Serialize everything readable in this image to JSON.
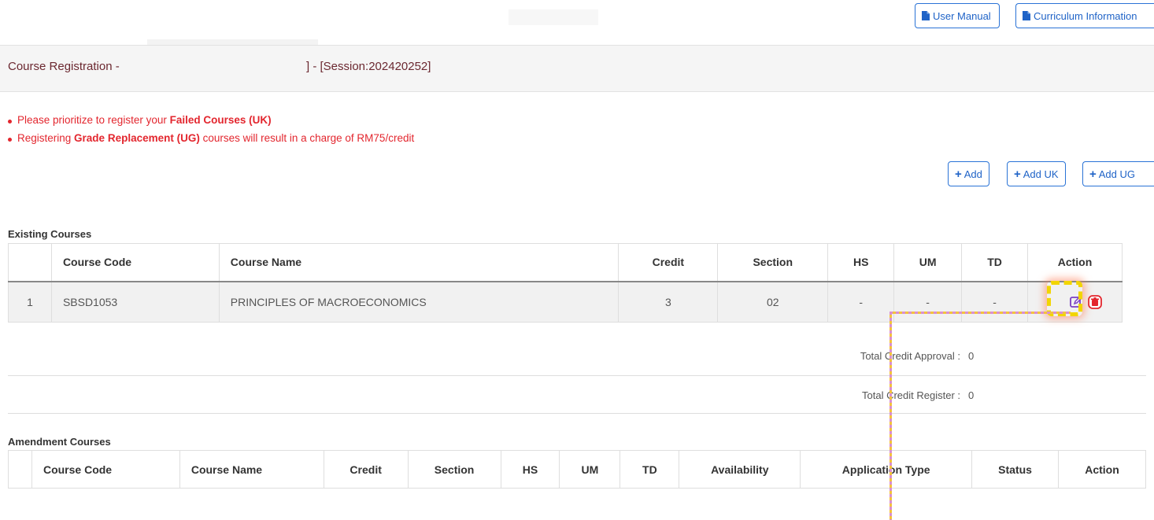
{
  "top_bar": {
    "user_manual_label": "User Manual",
    "curriculum_label": "Curriculum Information"
  },
  "header": {
    "title_prefix": "Course Registration -",
    "title_suffix": "] - [Session:202420252]"
  },
  "notices": [
    {
      "pre": "Please prioritize to register your ",
      "bold": "Failed Courses (UK)",
      "post": ""
    },
    {
      "pre": "Registering ",
      "bold": "Grade Replacement (UG)",
      "post": " courses will result in a charge of RM75/credit"
    }
  ],
  "add_buttons": {
    "add": "Add",
    "add_uk": "Add UK",
    "add_ug": "Add UG"
  },
  "existing": {
    "title": "Existing Courses",
    "columns": [
      "",
      "Course Code",
      "Course Name",
      "Credit",
      "Section",
      "HS",
      "UM",
      "TD",
      "Action"
    ],
    "rows": [
      {
        "no": "1",
        "code": "SBSD1053",
        "name": "PRINCIPLES OF MACROECONOMICS",
        "credit": "3",
        "section": "02",
        "hs": "-",
        "um": "-",
        "td": "-"
      }
    ]
  },
  "totals": {
    "approval_label": "Total Credit Approval :",
    "approval_value": "0",
    "register_label": "Total Credit Register :",
    "register_value": "0"
  },
  "amendment": {
    "title": "Amendment Courses",
    "columns": [
      "",
      "Course Code",
      "Course Name",
      "Credit",
      "Section",
      "HS",
      "UM",
      "TD",
      "Availability",
      "Application Type",
      "Status",
      "Action"
    ]
  },
  "colors": {
    "primary_blue": "#2a73d6",
    "notice_red": "#e3262e",
    "header_text": "#6b2830",
    "edit_purple": "#7b3fc4",
    "delete_red": "#e3262e",
    "highlight_yellow": "#f2d500"
  },
  "icons": {
    "doc": "file-icon",
    "edit": "edit-icon",
    "delete": "trash-icon",
    "plus": "plus-icon"
  }
}
